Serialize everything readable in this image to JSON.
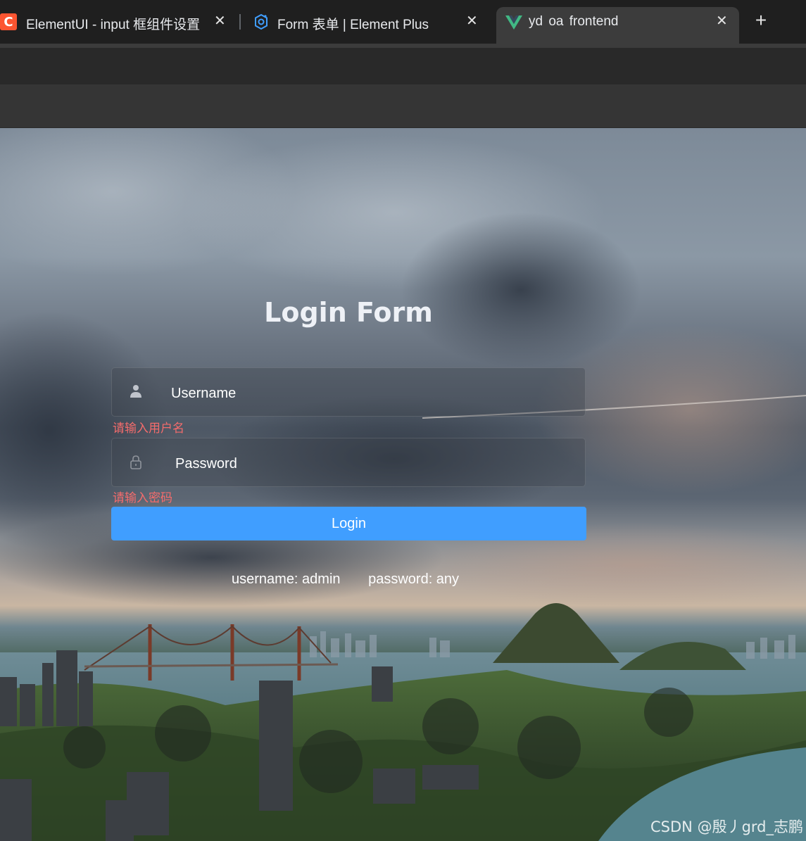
{
  "browser": {
    "tabs": [
      {
        "title": "ElementUI - input 框组件设置",
        "favicon_letter": "C",
        "favicon_color": "#fc5531"
      },
      {
        "title": "Form 表单 | Element Plus",
        "favicon_color": "#409eff"
      },
      {
        "title": "yd oa frontend",
        "favicon_color": "#41b883",
        "active": true
      }
    ],
    "new_tab_label": "+",
    "close_label": "✕"
  },
  "login": {
    "title": "Login Form",
    "username_placeholder": "Username",
    "username_error": "请输入用户名",
    "password_placeholder": "Password",
    "password_error": "请输入密码",
    "button_label": "Login",
    "tip_username": "username: admin",
    "tip_password": "password: any"
  },
  "watermark": "CSDN @殷丿grd_志鹏",
  "colors": {
    "primary": "#409eff",
    "error": "#f56c6c"
  }
}
